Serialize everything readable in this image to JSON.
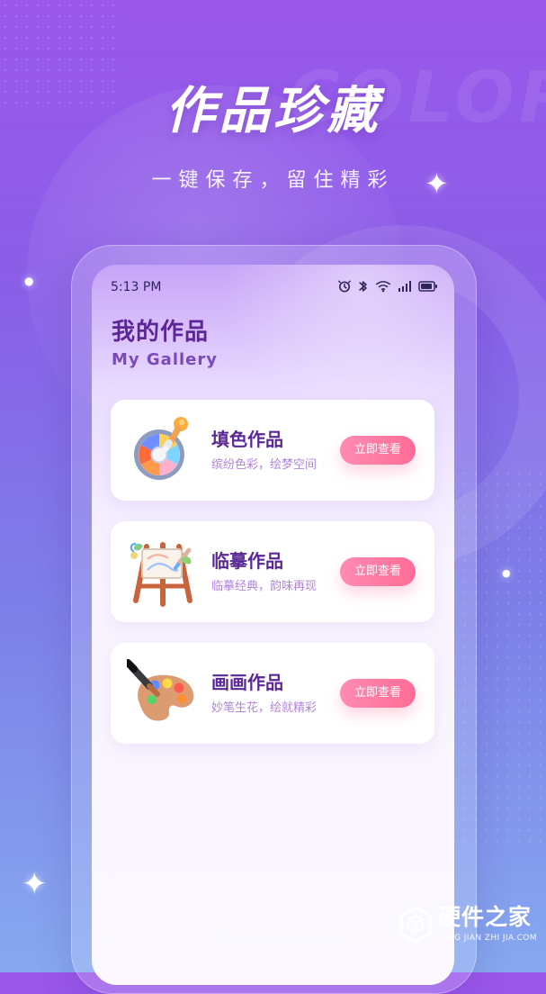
{
  "background": {
    "decorative_word": "COLOR"
  },
  "hero": {
    "title": "作品珍藏",
    "subtitle": "一键保存，留住精彩"
  },
  "status_bar": {
    "time": "5:13 PM",
    "icons": [
      "alarm-icon",
      "bluetooth-icon",
      "wifi-icon",
      "signal-icon",
      "battery-icon"
    ]
  },
  "gallery": {
    "title": "我的作品",
    "subtitle": "My Gallery",
    "items": [
      {
        "title": "填色作品",
        "subtitle": "缤纷色彩，绘梦空间",
        "button_label": "立即查看",
        "icon": "color-wheel-brush-icon"
      },
      {
        "title": "临摹作品",
        "subtitle": "临摹经典，韵味再现",
        "button_label": "立即查看",
        "icon": "easel-icon"
      },
      {
        "title": "画画作品",
        "subtitle": "妙笔生花，绘就精彩",
        "button_label": "立即查看",
        "icon": "paint-palette-icon"
      }
    ]
  },
  "watermark": {
    "title": "硬件之家",
    "subtitle": "YING JIAN ZHI JIA.COM"
  },
  "colors": {
    "background_top": "#9a57ea",
    "background_bottom": "#86a8ef",
    "title_purple": "#5d2596",
    "subtitle_purple": "#b184d8",
    "button_pink": "#ff6c95"
  }
}
